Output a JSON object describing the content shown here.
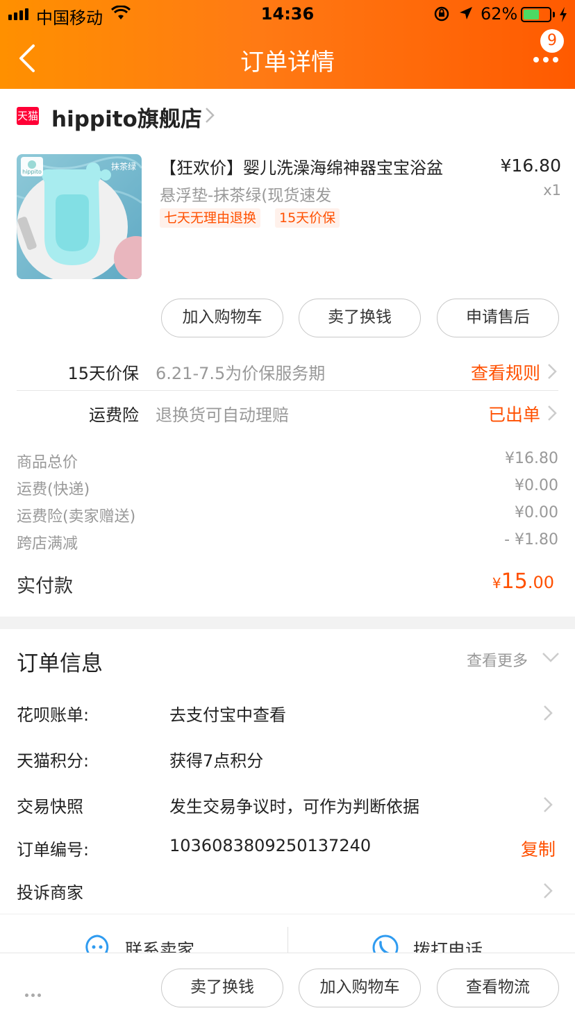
{
  "status_bar": {
    "carrier": "中国移动",
    "time": "14:36",
    "battery_percent_text": "62%",
    "battery_level": 0.62
  },
  "nav": {
    "title": "订单详情",
    "badge_count": "9",
    "back_icon": "chevron-left-icon",
    "more_icon": "more-dots-icon"
  },
  "store": {
    "logo_text": "天猫",
    "name": "hippito旗舰店"
  },
  "product": {
    "image_brand": "hippito",
    "image_color_label": "抹茶绿",
    "title": "【狂欢价】婴儿洗澡海绵神器宝宝浴盆",
    "sku": "悬浮垫-抹茶绿(现货速发",
    "price": "¥16.80",
    "quantity": "x1",
    "tags": [
      "七天无理由退换",
      "15天价保"
    ]
  },
  "item_actions": [
    "加入购物车",
    "卖了换钱",
    "申请售后"
  ],
  "services": [
    {
      "label": "15天价保",
      "desc": "6.21-7.5为价保服务期",
      "action": "查看规则"
    },
    {
      "label": "运费险",
      "desc": "退换货可自动理赔",
      "action": "已出单"
    }
  ],
  "summary": [
    {
      "label": "商品总价",
      "value": "¥16.80"
    },
    {
      "label": "运费(快递)",
      "value": "¥0.00"
    },
    {
      "label": "运费险(卖家赠送)",
      "value": "¥0.00"
    },
    {
      "label": "跨店满减",
      "value": "- ¥1.80"
    }
  ],
  "paid": {
    "label": "实付款",
    "currency": "¥",
    "integer": "15",
    "decimal": ".00"
  },
  "order_info": {
    "title": "订单信息",
    "more": "查看更多",
    "huabei": {
      "label": "花呗账单:",
      "value": "去支付宝中查看"
    },
    "points": {
      "label": "天猫积分:",
      "value": "获得7点积分"
    },
    "snapshot": {
      "label": "交易快照",
      "value": "发生交易争议时，可作为判断依据"
    },
    "order_no": {
      "label": "订单编号:",
      "value": "1036083809250137240",
      "copy": "复制"
    },
    "complain": {
      "label": "投诉商家"
    }
  },
  "contact": {
    "seller": "联系卖家",
    "phone": "拨打电话"
  },
  "bottom_actions": [
    "卖了换钱",
    "加入购物车",
    "查看物流"
  ],
  "colors": {
    "accent": "#ff5000",
    "header_start": "#ff9000",
    "header_end": "#ff5a00",
    "tmall_red": "#ff0036",
    "tag_bg": "#fff1eb",
    "contact_icon": "#2f9bf0"
  }
}
